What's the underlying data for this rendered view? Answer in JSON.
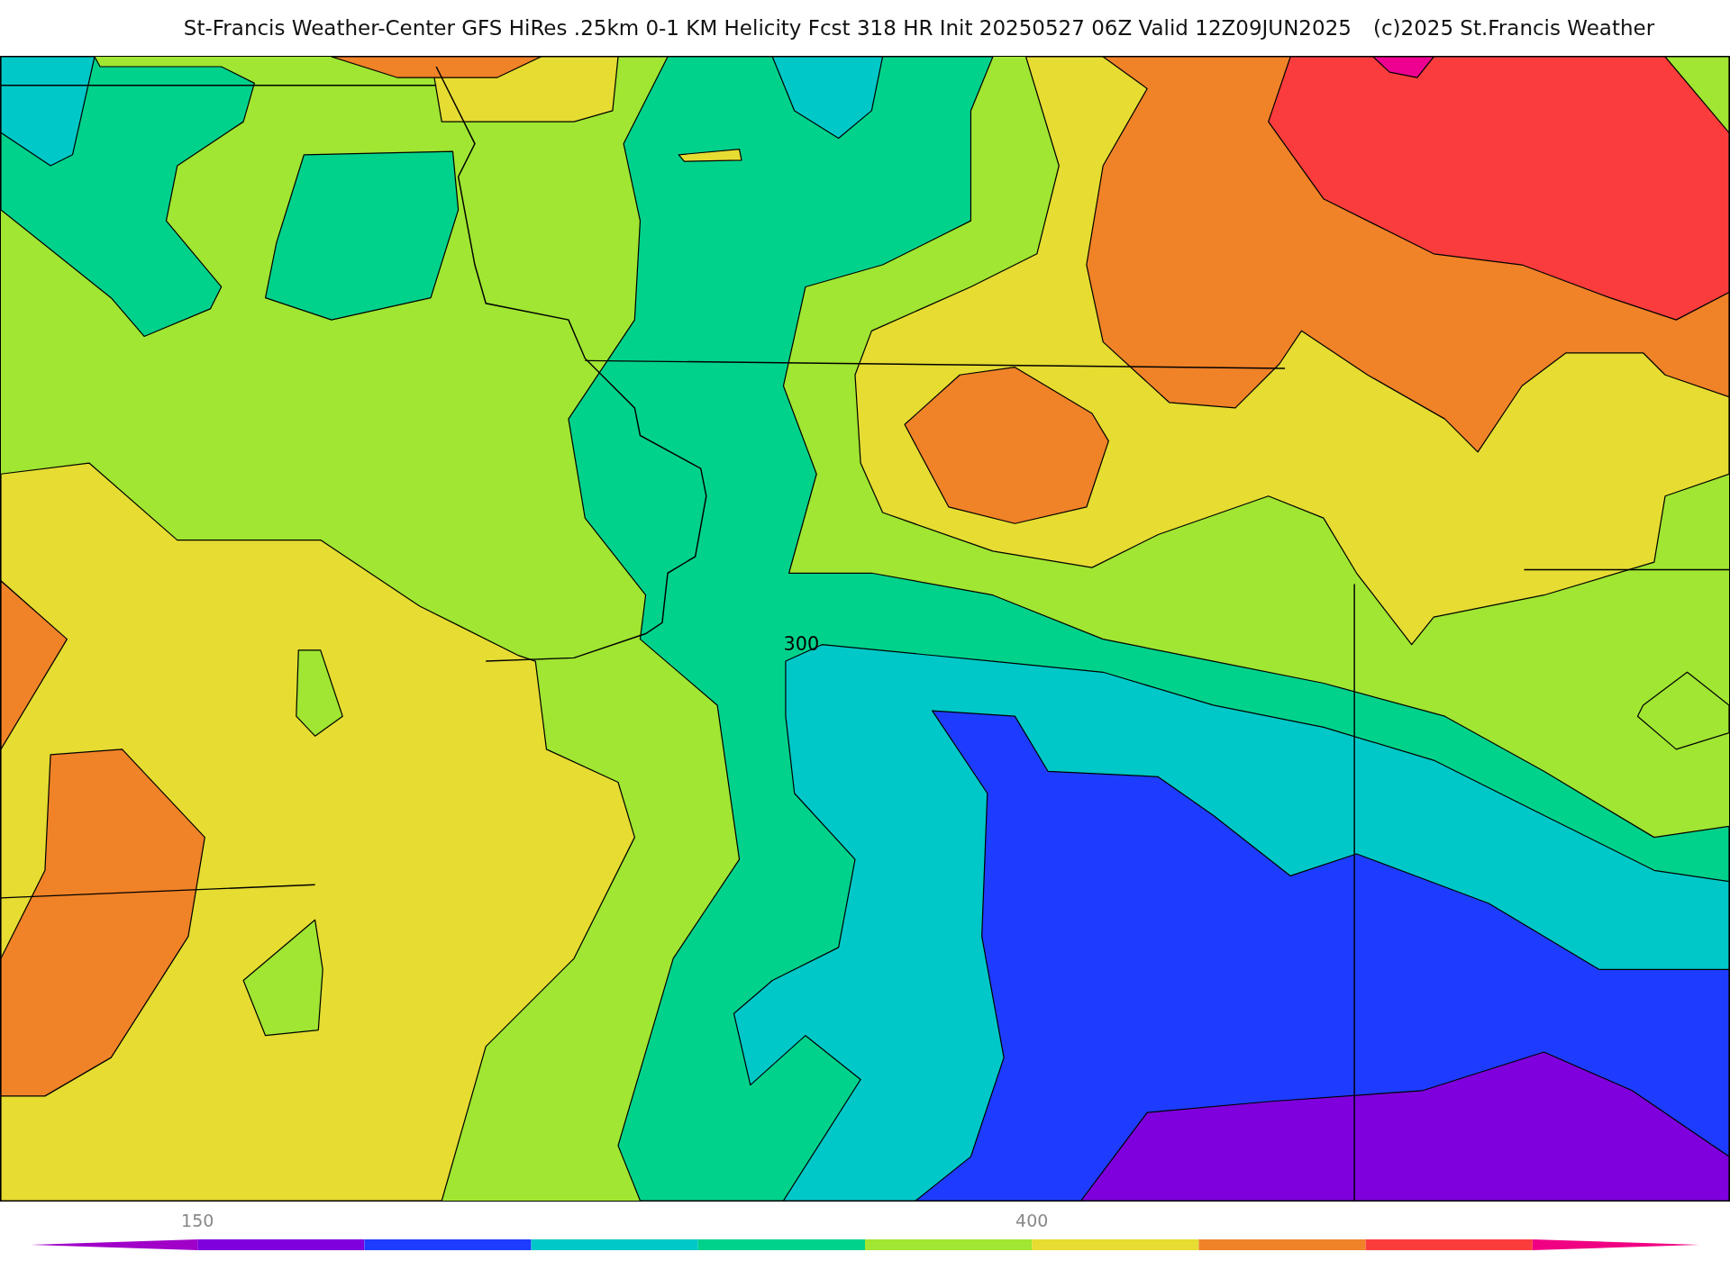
{
  "title": {
    "text": "St-Francis Weather-Center GFS HiRes .25km 0-1 KM Helicity Fcst 318 HR Init 20250527 06Z  Valid 12Z09JUN2025",
    "copyright": "(c)2025 St.Francis Weather"
  },
  "map": {
    "contour_label": "300"
  },
  "colorbar": {
    "segments": [
      {
        "kind": "triangle-left",
        "color": "#a000c8"
      },
      {
        "kind": "box",
        "color": "#7f00dc"
      },
      {
        "kind": "box",
        "color": "#1e3cff"
      },
      {
        "kind": "box",
        "color": "#00c8c8"
      },
      {
        "kind": "box",
        "color": "#00d28c"
      },
      {
        "kind": "box",
        "color": "#a0e632"
      },
      {
        "kind": "box",
        "color": "#e6dc32"
      },
      {
        "kind": "box",
        "color": "#f08228"
      },
      {
        "kind": "box",
        "color": "#fa3c3c"
      },
      {
        "kind": "triangle-right",
        "color": "#f00082"
      }
    ],
    "ticks": [
      {
        "label": "150"
      },
      {
        "label": "400"
      }
    ]
  }
}
